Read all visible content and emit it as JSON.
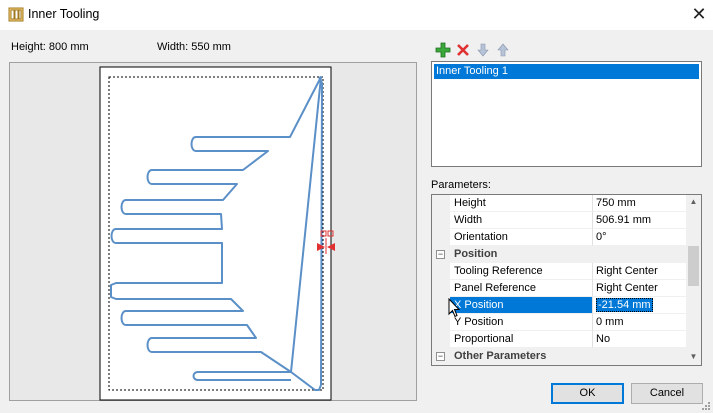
{
  "window": {
    "title": "Inner Tooling"
  },
  "dimensions": {
    "height_label": "Height: 800 mm",
    "width_label": "Width: 550 mm"
  },
  "toolbar": {
    "icons": [
      "add-icon",
      "delete-icon",
      "move-down-icon",
      "move-up-icon"
    ]
  },
  "tooling_list": {
    "items": [
      "Inner Tooling 1"
    ],
    "selected": "Inner Tooling 1"
  },
  "parameters": {
    "label": "Parameters:",
    "rows": [
      {
        "name": "Height",
        "value": "750 mm"
      },
      {
        "name": "Width",
        "value": "506.91 mm"
      },
      {
        "name": "Orientation",
        "value": "0°"
      }
    ],
    "position_category": "Position",
    "position_rows": [
      {
        "name": "Tooling Reference",
        "value": "Right Center"
      },
      {
        "name": "Panel Reference",
        "value": "Right Center"
      },
      {
        "name": "X Position",
        "value": "-21.54 mm"
      },
      {
        "name": "Y Position",
        "value": "0 mm"
      },
      {
        "name": "Proportional",
        "value": "No"
      }
    ],
    "other_category": "Other Parameters"
  },
  "buttons": {
    "ok": "OK",
    "cancel": "Cancel"
  },
  "colors": {
    "accent": "#0078d7",
    "tooling_outline": "#5b8fc7",
    "handle": "#e03030"
  }
}
